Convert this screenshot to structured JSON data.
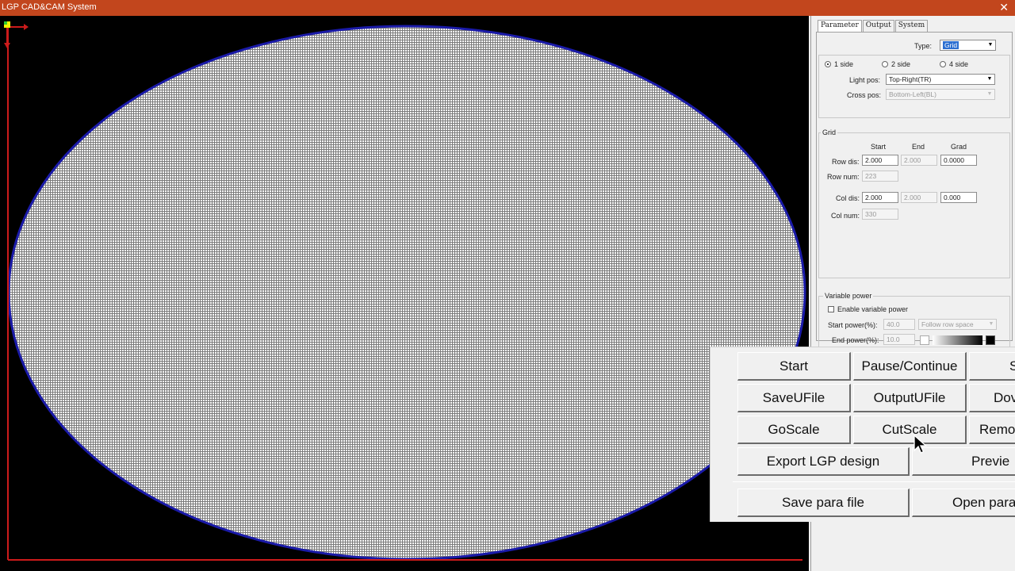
{
  "window": {
    "title": "LGP CAD&CAM System",
    "close_glyph": "✕"
  },
  "tabs": [
    "Parameter",
    "Output",
    "System"
  ],
  "parameter": {
    "type_label": "Type:",
    "type_value": "Grid",
    "sides": [
      {
        "label": "1 side",
        "selected": true
      },
      {
        "label": "2 side",
        "selected": false
      },
      {
        "label": "4 side",
        "selected": false
      }
    ],
    "light_pos_label": "Light pos:",
    "light_pos_value": "Top-Right(TR)",
    "cross_pos_label": "Cross pos:",
    "cross_pos_value": "Bottom-Left(BL)",
    "grid": {
      "title": "Grid",
      "col_headers": [
        "Start",
        "End",
        "Grad"
      ],
      "row_dis_label": "Row dis:",
      "row_dis": [
        "2.000",
        "2.000",
        "0.0000"
      ],
      "row_num_label": "Row num:",
      "row_num": "223",
      "col_dis_label": "Col dis:",
      "col_dis": [
        "2.000",
        "2.000",
        "0.000"
      ],
      "col_num_label": "Col num:",
      "col_num": "330"
    },
    "variable_power": {
      "title": "Variable power",
      "enable_label": "Enable variable power",
      "start_power_label": "Start power(%):",
      "start_power_value": "40.0",
      "follow_value": "Follow row space",
      "end_power_label": "End power(%):",
      "end_power_value": "10.0"
    }
  },
  "buttons": {
    "start": "Start",
    "pause_continue": "Pause/Continue",
    "row1_col3": "S",
    "save_ufile": "SaveUFile",
    "output_ufile": "OutputUFile",
    "download": "Dov",
    "go_scale": "GoScale",
    "cut_scale": "CutScale",
    "remove": "Remo",
    "export_lgp": "Export LGP design",
    "preview": "Previe",
    "save_para": "Save para file",
    "open_para": "Open para"
  },
  "colors": {
    "titlebar": "#c2461d",
    "ellipse_outline": "#1a1aa8",
    "axis": "#cc1b1b",
    "selection": "#2c6fd1"
  }
}
